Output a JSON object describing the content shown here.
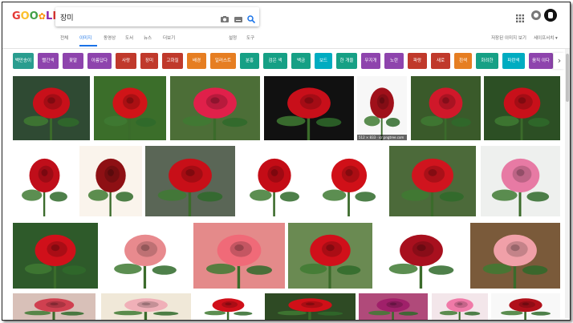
{
  "logo": {
    "letters": [
      "G",
      "O",
      "O",
      "G",
      "L",
      "E"
    ],
    "colors": [
      "#e53935",
      "#fbc02d",
      "#43a047",
      "#1e88e5",
      "#8e24aa",
      "#e53935"
    ],
    "flower": "✿"
  },
  "search": {
    "query": "장미",
    "camera_icon": "camera-icon",
    "keyboard_icon": "keyboard-icon",
    "search_icon": "search-icon"
  },
  "header_icons": {
    "apps": "apps-grid-icon",
    "notifications": "notifications-icon",
    "account": "account-avatar-icon"
  },
  "tabs": [
    "전체",
    "이미지",
    "동영상",
    "도서",
    "뉴스",
    "더보기"
  ],
  "active_tab": "이미지",
  "right_tabs": [
    "설정",
    "도구"
  ],
  "far_right": {
    "saved": "저장된 이미지 보기",
    "safesearch": "세이프서치 ▾"
  },
  "chips": [
    {
      "label": "백만송이",
      "color": "#2a9d8f"
    },
    {
      "label": "빨간색",
      "color": "#8e44ad"
    },
    {
      "label": "꽃말",
      "color": "#8e44ad"
    },
    {
      "label": "아름답다",
      "color": "#8e44ad"
    },
    {
      "label": "사랑",
      "color": "#c0392b"
    },
    {
      "label": "장미",
      "color": "#c0392b"
    },
    {
      "label": "고화질",
      "color": "#c0392b"
    },
    {
      "label": "배경",
      "color": "#e67e22"
    },
    {
      "label": "일러스트",
      "color": "#e67e22"
    },
    {
      "label": "분홍",
      "color": "#16a085"
    },
    {
      "label": "검은 색",
      "color": "#16a085"
    },
    {
      "label": "백금",
      "color": "#16a085"
    },
    {
      "label": "보드",
      "color": "#00acc1"
    },
    {
      "label": "한 개울",
      "color": "#16a085"
    },
    {
      "label": "무지개",
      "color": "#8e44ad"
    },
    {
      "label": "노란",
      "color": "#8e44ad"
    },
    {
      "label": "파랑",
      "color": "#c0392b"
    },
    {
      "label": "새로",
      "color": "#c0392b"
    },
    {
      "label": "흰색",
      "color": "#e67e22"
    },
    {
      "label": "화려한",
      "color": "#16a085"
    },
    {
      "label": "파란색",
      "color": "#00acc1"
    },
    {
      "label": "움직 이다",
      "color": "#8e44ad"
    }
  ],
  "image_caption": "512 × 833 · icr.pngtree.com",
  "image_tiles": [
    {
      "bg": "#2f4a33",
      "rose": "#c8101a"
    },
    {
      "bg": "#3b6e2a",
      "rose": "#d01418"
    },
    {
      "bg": "#4c6e37",
      "rose": "#e0204a"
    },
    {
      "bg": "#111111",
      "rose": "#c80f1a"
    },
    {
      "bg": "#f7f7f7",
      "rose": "#a0101a"
    },
    {
      "bg": "#3a5a2a",
      "rose": "#d0182a"
    },
    {
      "bg": "#2c4f24",
      "rose": "#c8101a"
    },
    {
      "bg": "#ffffff",
      "rose": "#c00e1a"
    },
    {
      "bg": "#faf4ec",
      "rose": "#8e1014"
    },
    {
      "bg": "#5a6656",
      "rose": "#c80f18"
    },
    {
      "bg": "#ffffff",
      "rose": "#c40c16"
    },
    {
      "bg": "#ffffff",
      "rose": "#d01018"
    },
    {
      "bg": "#4c6a3a",
      "rose": "#d0141e"
    },
    {
      "bg": "#eef0ee",
      "rose": "#e77aa4"
    },
    {
      "bg": "#2e5a2a",
      "rose": "#d0101a"
    },
    {
      "bg": "#ffffff",
      "rose": "#e88a8e"
    },
    {
      "bg": "#e48a8a",
      "rose": "#f06a78"
    },
    {
      "bg": "#6a8a52",
      "rose": "#d0101a"
    },
    {
      "bg": "#ffffff",
      "rose": "#a8101e"
    },
    {
      "bg": "#7a5a3a",
      "rose": "#f0a0a8"
    },
    {
      "bg": "#d8c0b8",
      "rose": "#d04050"
    },
    {
      "bg": "#f0e8d8",
      "rose": "#f0b0b8"
    },
    {
      "bg": "#ffffff",
      "rose": "#d0101a"
    },
    {
      "bg": "#2e4a24",
      "rose": "#d01018"
    },
    {
      "bg": "#b04a7a",
      "rose": "#a0206a"
    },
    {
      "bg": "#f3e6ea",
      "rose": "#f07aa8"
    },
    {
      "bg": "#f8f8f8",
      "rose": "#b0101a"
    }
  ]
}
